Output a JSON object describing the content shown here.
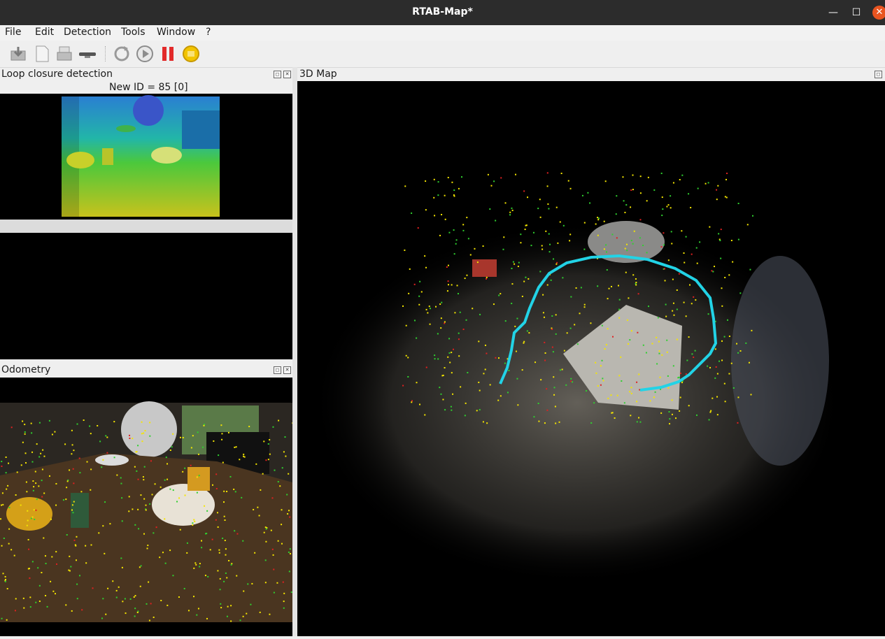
{
  "window": {
    "title": "RTAB-Map*",
    "controls": [
      "—",
      "☐",
      "✕"
    ]
  },
  "menu": [
    "File",
    "Edit",
    "Detection",
    "Tools",
    "Window",
    "?"
  ],
  "toolbar": [
    "save-icon",
    "new-icon",
    "open-icon",
    "camera-icon",
    "refresh-icon",
    "play-icon",
    "pause-icon",
    "stop-icon"
  ],
  "loop_closure": {
    "title": "Loop closure detection",
    "new_id": "New ID = 85 [0]"
  },
  "odometry": {
    "title": "Odometry"
  },
  "map3d": {
    "title": "3D Map"
  },
  "colors": {
    "trajectory": "#22d3e6",
    "feature_yellow": "#f5e600",
    "feature_green": "#2fd02f",
    "feature_red": "#e02020"
  }
}
